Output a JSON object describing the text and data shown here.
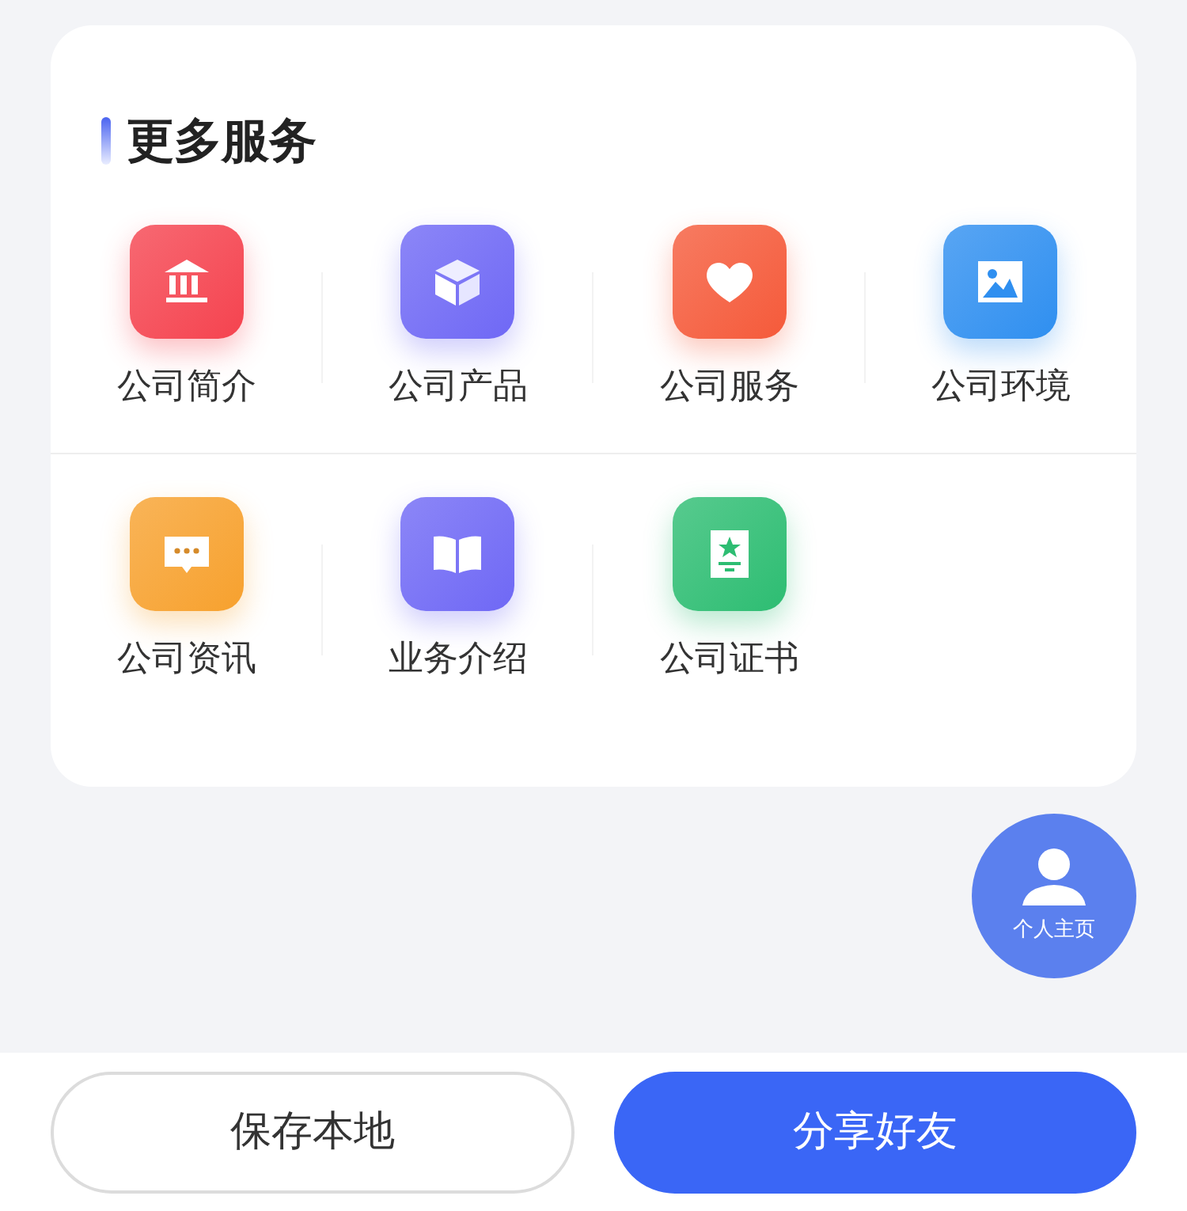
{
  "section": {
    "title": "更多服务"
  },
  "services": [
    {
      "label": "公司简介",
      "kind": "bank",
      "color": "#f5434f"
    },
    {
      "label": "公司产品",
      "kind": "box",
      "color": "#6f68f5"
    },
    {
      "label": "公司服务",
      "kind": "heart",
      "color": "#f55a3a"
    },
    {
      "label": "公司环境",
      "kind": "image",
      "color": "#2f8ff0"
    },
    {
      "label": "公司资讯",
      "kind": "chat",
      "color": "#f7a12e"
    },
    {
      "label": "业务介绍",
      "kind": "book",
      "color": "#6f68f5"
    },
    {
      "label": "公司证书",
      "kind": "certificate",
      "color": "#2dbd72"
    }
  ],
  "floating_button": {
    "label": "个人主页"
  },
  "buttons": [
    {
      "label": "保存本地",
      "kind": "outline"
    },
    {
      "label": "分享好友",
      "kind": "primary"
    }
  ]
}
